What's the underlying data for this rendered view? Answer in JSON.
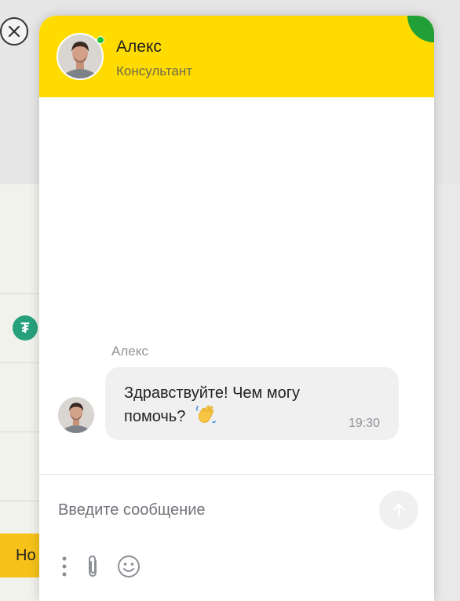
{
  "background": {
    "button_label": "Но",
    "coin_icon": "tether-coin-icon"
  },
  "close": {
    "icon": "close-icon"
  },
  "header": {
    "agent_name": "Алекс",
    "agent_role": "Консультант",
    "status": "online",
    "accent_color": "#ffdb00",
    "corner_color": "#21a038"
  },
  "chat": {
    "messages": [
      {
        "sender": "Алекс",
        "text": "Здравствуйте! Чем могу помочь?",
        "emoji": "waving-hand-icon",
        "time": "19:30"
      }
    ]
  },
  "composer": {
    "placeholder": "Введите сообщение",
    "value": "",
    "send_icon": "arrow-up-icon",
    "tools": [
      "more-options-icon",
      "paperclip-icon",
      "smiley-icon"
    ]
  }
}
